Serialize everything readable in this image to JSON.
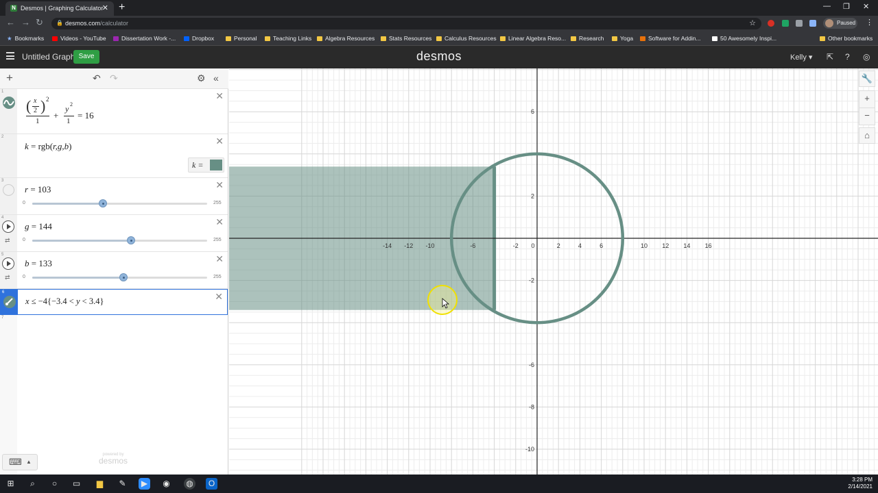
{
  "browser": {
    "tab_title": "Desmos | Graphing Calculator",
    "url_host": "desmos.com",
    "url_path": "/calculator",
    "profile_status": "Paused",
    "bookmarks": [
      "Bookmarks",
      "Videos - YouTube",
      "Dissertation Work -...",
      "Dropbox",
      "Personal",
      "Teaching Links",
      "Algebra Resources",
      "Stats Resources",
      "Calculus Resources",
      "Linear Algebra Reso...",
      "Research",
      "Yoga",
      "Software for Addin...",
      "50 Awesomely Inspi...",
      "Other bookmarks"
    ]
  },
  "header": {
    "graph_title": "Untitled Graph",
    "save_label": "Save",
    "logo": "desmos",
    "user": "Kelly ▾"
  },
  "expressions": [
    {
      "id": "1",
      "latex": "(x/2)^2/1 + y^2/1 = 16",
      "eq_rhs": "= 16",
      "plus": "+",
      "one": "1",
      "x": "x",
      "two": "2",
      "y": "y",
      "sq": "2"
    },
    {
      "id": "2",
      "lhs": "k",
      "eq": " = rgb(",
      "args": "r,g,b",
      "close": ")",
      "swatch_label": "k  =",
      "swatch_color": "#678f85"
    },
    {
      "id": "3",
      "var": "r",
      "eq": " = 103",
      "min": "0",
      "max": "255",
      "value": 103
    },
    {
      "id": "4",
      "var": "g",
      "eq": " = 144",
      "min": "0",
      "max": "255",
      "value": 144
    },
    {
      "id": "5",
      "var": "b",
      "eq": " = 133",
      "min": "0",
      "max": "255",
      "value": 133
    },
    {
      "id": "6",
      "text_a": "x",
      "text_b": " ≤ −4{−3.4 < ",
      "text_c": "y",
      "text_d": " < 3.4}"
    }
  ],
  "expression_numbers": [
    "1",
    "2",
    "3",
    "4",
    "5",
    "6",
    "7"
  ],
  "powered_by": {
    "small": "powered by",
    "logo": "desmos"
  },
  "graph": {
    "curve_color": "#678f85",
    "x_ticks": [
      "-14",
      "-12",
      "-10",
      "-6",
      "-2",
      "0",
      "2",
      "4",
      "6",
      "10",
      "12",
      "14",
      "16"
    ],
    "y_ticks": [
      "6",
      "2",
      "-2",
      "-6",
      "-8",
      "-10"
    ]
  },
  "taskbar": {
    "time": "3:28 PM",
    "date": "2/14/2021"
  }
}
